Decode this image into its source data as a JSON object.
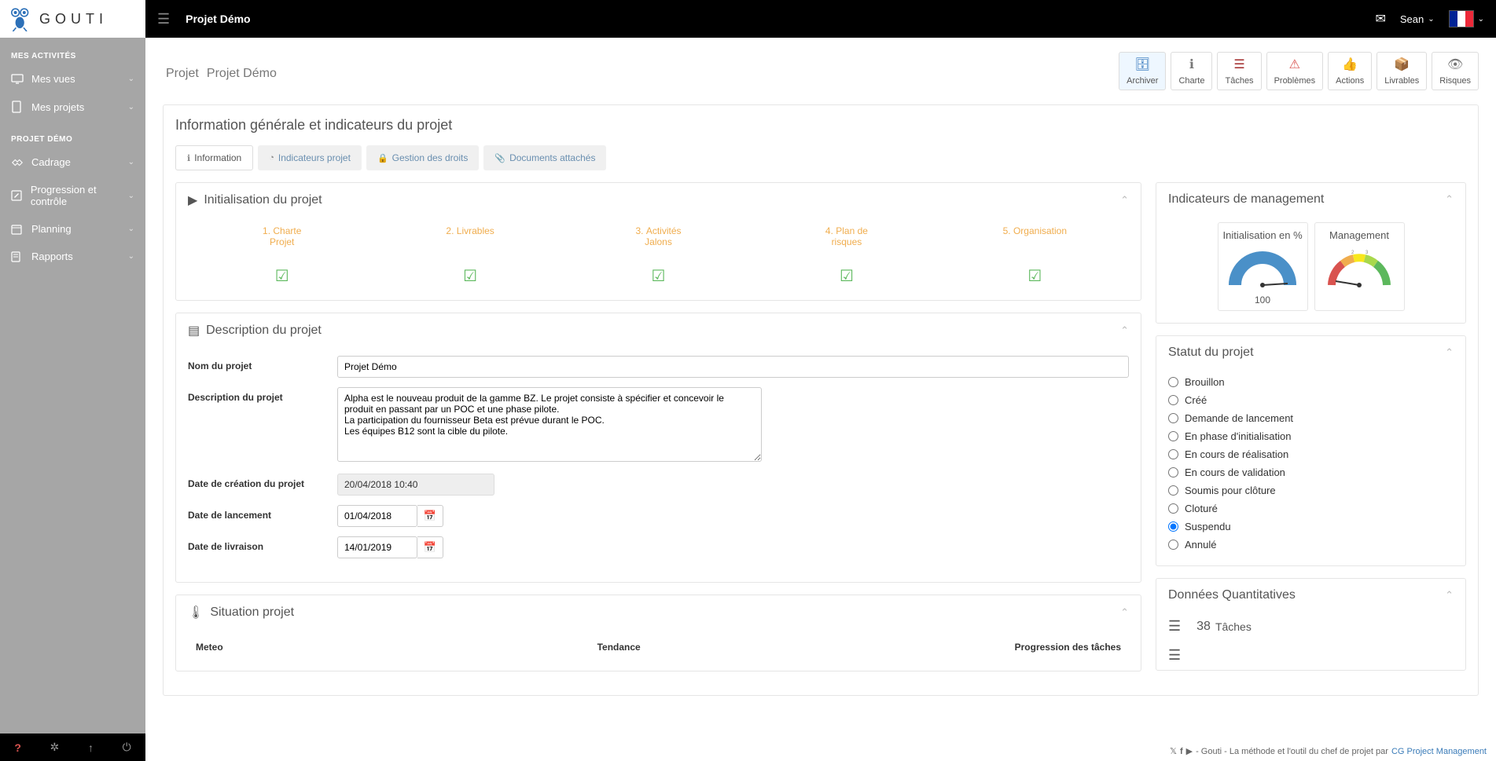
{
  "app": {
    "logo_text": "GOUTI",
    "top_title": "Projet Démo",
    "user": "Sean"
  },
  "sidebar": {
    "section1": "MES ACTIVITÉS",
    "items1": [
      {
        "label": "Mes vues",
        "icon": "monitor"
      },
      {
        "label": "Mes projets",
        "icon": "doc"
      }
    ],
    "section2": "PROJET DÉMO",
    "items2": [
      {
        "label": "Cadrage",
        "icon": "handshake"
      },
      {
        "label": "Progression et contrôle",
        "icon": "edit"
      },
      {
        "label": "Planning",
        "icon": "calendar"
      },
      {
        "label": "Rapports",
        "icon": "report"
      }
    ]
  },
  "page": {
    "title": "Projet",
    "subtitle": "Projet Démo"
  },
  "actions": [
    {
      "label": "Archiver",
      "icon": "archive",
      "color": "blue",
      "active": true
    },
    {
      "label": "Charte",
      "icon": "info",
      "color": "gray"
    },
    {
      "label": "Tâches",
      "icon": "tasks",
      "color": "darkred"
    },
    {
      "label": "Problèmes",
      "icon": "warning",
      "color": "red"
    },
    {
      "label": "Actions",
      "icon": "thumbsup",
      "color": "blue"
    },
    {
      "label": "Livrables",
      "icon": "boxes",
      "color": "gray"
    },
    {
      "label": "Risques",
      "icon": "eye",
      "color": "gray"
    }
  ],
  "info_panel_title": "Information générale et indicateurs du projet",
  "tabs": [
    {
      "label": "Information",
      "icon": "info",
      "active": true
    },
    {
      "label": "Indicateurs projet",
      "icon": "gauge"
    },
    {
      "label": "Gestion des droits",
      "icon": "lock"
    },
    {
      "label": "Documents attachés",
      "icon": "attach"
    }
  ],
  "init": {
    "title": "Initialisation du projet",
    "steps": [
      "1. Charte Projet",
      "2. Livrables",
      "3. Activités Jalons",
      "4. Plan de risques",
      "5. Organisation"
    ]
  },
  "desc": {
    "title": "Description du projet",
    "name_label": "Nom du projet",
    "name_value": "Projet Démo",
    "desc_label": "Description du projet",
    "desc_value": "Alpha est le nouveau produit de la gamme BZ. Le projet consiste à spécifier et concevoir le produit en passant par un POC et une phase pilote.\nLa participation du fournisseur Beta est prévue durant le POC.\nLes équipes B12 sont la cible du pilote.",
    "created_label": "Date de création du projet",
    "created_value": "20/04/2018 10:40",
    "launch_label": "Date de lancement",
    "launch_value": "01/04/2018",
    "delivery_label": "Date de livraison",
    "delivery_value": "14/01/2019"
  },
  "situation": {
    "title": "Situation projet",
    "cols": [
      "Meteo",
      "Tendance",
      "Progression des tâches"
    ]
  },
  "mgmt_ind": {
    "title": "Indicateurs de management",
    "gauges": [
      {
        "title": "Initialisation en %",
        "value": "100"
      },
      {
        "title": "Management",
        "value": ""
      }
    ]
  },
  "status": {
    "title": "Statut du projet",
    "options": [
      "Brouillon",
      "Créé",
      "Demande de lancement",
      "En phase d'initialisation",
      "En cours de réalisation",
      "En cours de validation",
      "Soumis pour clôture",
      "Cloturé",
      "Suspendu",
      "Annulé"
    ],
    "selected": "Suspendu"
  },
  "quant": {
    "title": "Données Quantitatives",
    "row1_value": "38",
    "row1_label": "Tâches"
  },
  "footer": {
    "text": " - Gouti - La méthode et l'outil du chef de projet par ",
    "company": "CG Project Management"
  },
  "chart_data": [
    {
      "type": "gauge",
      "title": "Initialisation en %",
      "value": 100,
      "min": 0,
      "max": 100
    },
    {
      "type": "gauge",
      "title": "Management",
      "value": 0.5,
      "min": 0,
      "max": 5,
      "ticks": [
        2,
        3
      ]
    }
  ]
}
